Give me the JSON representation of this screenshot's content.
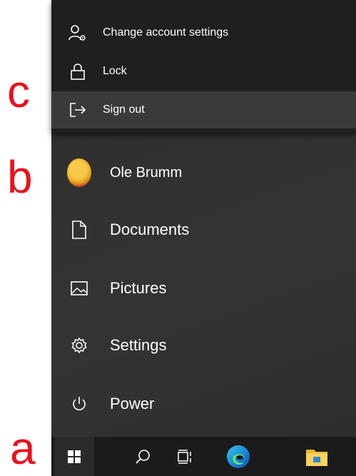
{
  "annotations": {
    "a": "a",
    "b": "b",
    "c": "c"
  },
  "account_menu": {
    "items": [
      {
        "label": "Change account settings",
        "icon": "account-settings-icon"
      },
      {
        "label": "Lock",
        "icon": "lock-icon"
      },
      {
        "label": "Sign out",
        "icon": "sign-out-icon"
      }
    ]
  },
  "start_menu": {
    "user": {
      "name": "Ole Brumm",
      "icon": "avatar"
    },
    "items": [
      {
        "label": "Documents",
        "icon": "document-icon"
      },
      {
        "label": "Pictures",
        "icon": "pictures-icon"
      },
      {
        "label": "Settings",
        "icon": "gear-icon"
      },
      {
        "label": "Power",
        "icon": "power-icon"
      }
    ]
  },
  "taskbar": {
    "buttons": [
      "windows-start-icon",
      "search-icon",
      "task-view-icon",
      "edge-icon",
      "file-explorer-icon"
    ]
  },
  "colors": {
    "annotation": "#e8121d",
    "menu_background": "#2f2f2f",
    "flyout_background": "#1f1f1f",
    "hover": "#3a3a3a",
    "taskbar": "#1b1b1b"
  }
}
